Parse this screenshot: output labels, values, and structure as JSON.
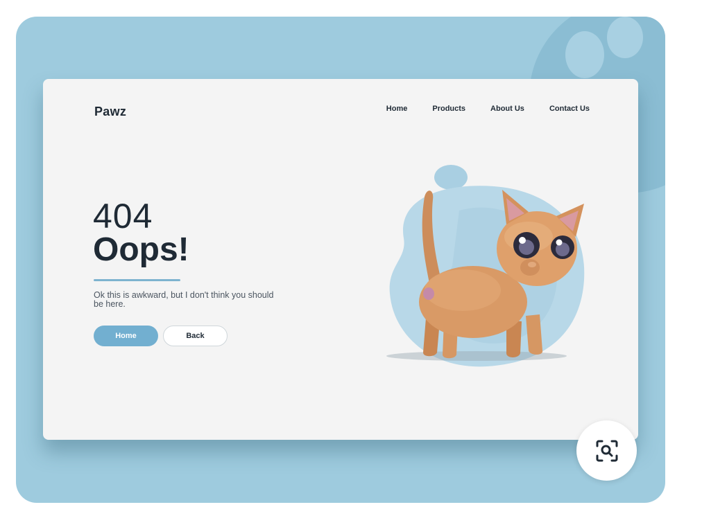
{
  "brand": {
    "name": "Pawz"
  },
  "nav": {
    "items": [
      {
        "label": "Home"
      },
      {
        "label": "Products"
      },
      {
        "label": "About Us"
      },
      {
        "label": "Contact Us"
      }
    ]
  },
  "hero": {
    "code": "404",
    "headline": "Oops!",
    "message": "Ok this is awkward, but I don't think you should be here.",
    "primary_button": "Home",
    "secondary_button": "Back"
  },
  "illustration": {
    "subject": "cat-illustration"
  },
  "overlay": {
    "icon": "visual-search-icon"
  },
  "colors": {
    "frame_bg": "#9ecbde",
    "card_bg": "#f4f4f4",
    "accent": "#72afd0",
    "text_dark": "#1f2a35"
  }
}
